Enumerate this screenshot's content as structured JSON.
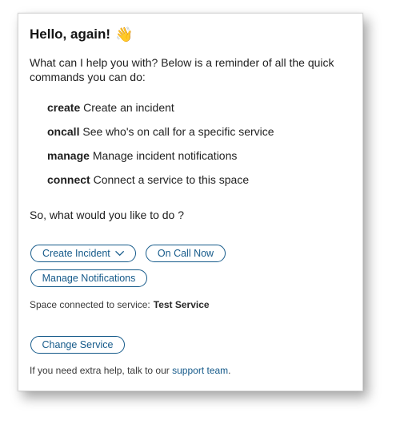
{
  "header": {
    "title": "Hello, again!",
    "wave_emoji": "👋"
  },
  "intro": "What can I help you with? Below is a reminder of all the quick commands you can do:",
  "commands": [
    {
      "keyword": "create",
      "description": "Create an incident"
    },
    {
      "keyword": "oncall",
      "description": "See who's on call for a specific service"
    },
    {
      "keyword": "manage",
      "description": "Manage incident notifications"
    },
    {
      "keyword": "connect",
      "description": "Connect a service to this space"
    }
  ],
  "prompt": "So, what would you like to do ?",
  "buttons": {
    "create_incident": "Create Incident",
    "on_call_now": "On Call Now",
    "manage_notifications": "Manage Notifications",
    "change_service": "Change Service"
  },
  "service": {
    "label": "Space connected to service:",
    "name": "Test Service"
  },
  "help": {
    "text": "If you need extra help, talk to our",
    "link": "support team",
    "suffix": "."
  },
  "colors": {
    "accent": "#155a8a",
    "text": "#1f1f1f",
    "card_border": "#d6d6d6"
  },
  "icons": {
    "dropdown": "chevron-down-icon",
    "greeting": "waving-hand-icon"
  }
}
